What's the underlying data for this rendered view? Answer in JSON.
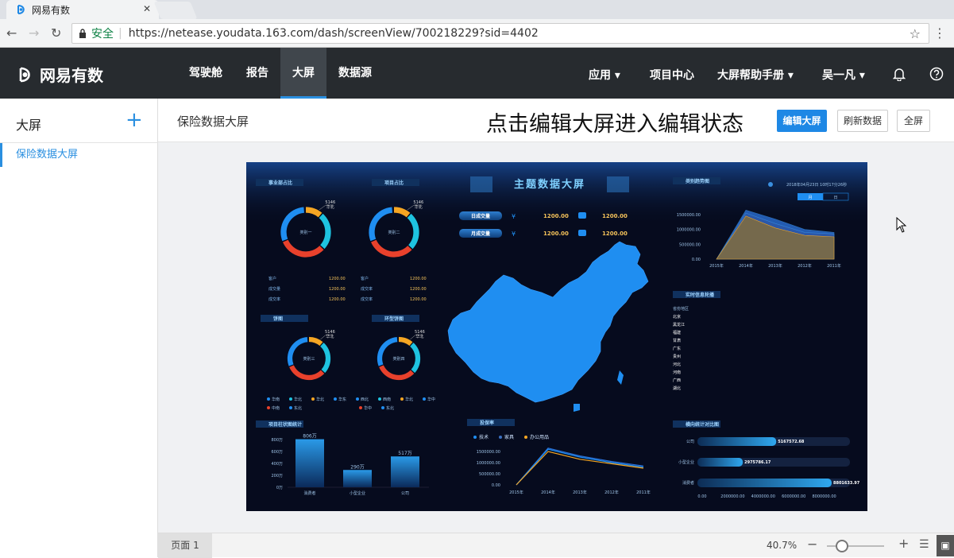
{
  "browser": {
    "tab_title": "网易有数",
    "tab_close": "✕",
    "security_label": "安全",
    "url": "https://netease.youdata.163.com/dash/screenView/700218229?sid=4402"
  },
  "app": {
    "brand": "网易有数",
    "nav": [
      "驾驶舱",
      "报告",
      "大屏",
      "数据源"
    ],
    "active_nav": "大屏",
    "right_nav": {
      "apps": "应用",
      "project_center": "项目中心",
      "help": "大屏帮助手册",
      "user": "吴一凡"
    }
  },
  "sidebar": {
    "title": "大屏",
    "add_icon": "+",
    "items": [
      {
        "label": "保险数据大屏"
      }
    ]
  },
  "toolbar": {
    "breadcrumb": "保险数据大屏",
    "tip": "点击编辑大屏进入编辑状态",
    "edit": "编辑大屏",
    "refresh": "刷新数据",
    "fullscreen": "全屏"
  },
  "footer": {
    "page": "页面 1",
    "zoom": "40.7%",
    "zoom_level": 0.407
  },
  "colors": {
    "accent": "#1e88e5",
    "appbar": "#272b2f",
    "canvas_bg": "#060b1e",
    "map": "#1f8ef1",
    "orange": "#f5a623",
    "red": "#e8412c",
    "cyan": "#1ec3e0"
  },
  "dashboard": {
    "title": "主题数据大屏",
    "panels": {
      "business_ratio": "事业部占比",
      "project_ratio": "项目占比",
      "pie": "饼图",
      "ring": "环型饼图",
      "bar_stats": "项目柱状图统计",
      "insurance_rate": "投保率",
      "trend": "类别趋势图",
      "realtime": "实时信息轮播",
      "horizontal": "横向统计对比图"
    },
    "donuts": [
      {
        "center": "类别一",
        "value": "5146",
        "name": "华北"
      },
      {
        "center": "类别二",
        "value": "5146",
        "name": "华北"
      },
      {
        "center": "类别三",
        "value": "5146",
        "name": "华北"
      },
      {
        "center": "类别四",
        "value": "5146",
        "name": "华北"
      }
    ],
    "kpis": [
      {
        "label": "日成交量",
        "value1": "1200.00",
        "value2": "1200.00"
      },
      {
        "label": "月成交量",
        "value1": "1200.00",
        "value2": "1200.00"
      }
    ],
    "mini_table_left": [
      {
        "label": "客户",
        "value": "1200.00"
      },
      {
        "label": "成交量",
        "value": "1200.00"
      },
      {
        "label": "成交率",
        "value": "1200.00"
      }
    ],
    "mini_table_right": [
      {
        "label": "客户",
        "value": "1200.00"
      },
      {
        "label": "成交率",
        "value": "1200.00"
      },
      {
        "label": "成交率",
        "value": "1200.00"
      }
    ],
    "legend_row1": [
      "华南",
      "华北",
      "华北",
      "华东",
      "西北",
      "西南",
      "华北",
      "华中"
    ],
    "legend_row2": [
      "中南",
      "东北",
      "华中",
      "东北"
    ],
    "realtime_list": [
      "省份地区",
      "北京",
      "黑龙江",
      "福建",
      "甘肃",
      "广东",
      "贵州",
      "河北",
      "河南",
      "广西",
      "湖北"
    ],
    "trend_date": "2018年04月23日 10时17分26秒",
    "trend_toggle": [
      "月",
      "日"
    ],
    "rate_legend": [
      "技术",
      "家具",
      "办公用品"
    ]
  },
  "chart_data": [
    {
      "type": "bar",
      "title": "项目柱状图统计",
      "categories": [
        "消费者",
        "小型企业",
        "公司"
      ],
      "values": [
        806,
        290,
        517
      ],
      "value_labels": [
        "806万",
        "290万",
        "517万"
      ],
      "ylim": [
        0,
        800
      ],
      "yticks": [
        "0万",
        "200万",
        "400万",
        "600万",
        "800万"
      ]
    },
    {
      "type": "line",
      "title": "投保率",
      "x": [
        "2015年",
        "2014年",
        "2013年",
        "2012年",
        "2011年"
      ],
      "yticks": [
        "0.00",
        "500000.00",
        "1000000.00",
        "1500000.00"
      ],
      "ylim": [
        0,
        1500000
      ],
      "series": [
        {
          "name": "技术",
          "values": [
            0,
            1650000,
            1300000,
            1050000,
            850000
          ]
        },
        {
          "name": "家具",
          "values": [
            0,
            1600000,
            1250000,
            1000000,
            800000
          ]
        },
        {
          "name": "办公用品",
          "values": [
            0,
            1500000,
            1150000,
            950000,
            750000
          ]
        }
      ]
    },
    {
      "type": "area",
      "title": "类别趋势图",
      "x": [
        "2015年",
        "2014年",
        "2013年",
        "2012年",
        "2011年"
      ],
      "yticks": [
        "0.00",
        "500000.00",
        "1000000.00",
        "1500000.00"
      ],
      "ylim": [
        0,
        1500000
      ],
      "series": [
        {
          "values": [
            0,
            1650000,
            1350000,
            1000000,
            900000
          ]
        },
        {
          "values": [
            0,
            1550000,
            1200000,
            900000,
            850000
          ]
        },
        {
          "values": [
            0,
            1450000,
            1050000,
            800000,
            750000
          ]
        }
      ]
    },
    {
      "type": "bar",
      "orientation": "horizontal",
      "title": "横向统计对比图",
      "categories": [
        "公司",
        "小型企业",
        "消费者"
      ],
      "values": [
        5167572.68,
        2975786.17,
        8801633.97
      ],
      "value_labels": [
        "5167572.68",
        "2975786.17",
        "8801633.97"
      ],
      "ylim": [
        0,
        10000000
      ],
      "xticks": [
        "0.00",
        "2000000.00",
        "4000000.00",
        "6000000.00",
        "8000000.00"
      ]
    }
  ]
}
